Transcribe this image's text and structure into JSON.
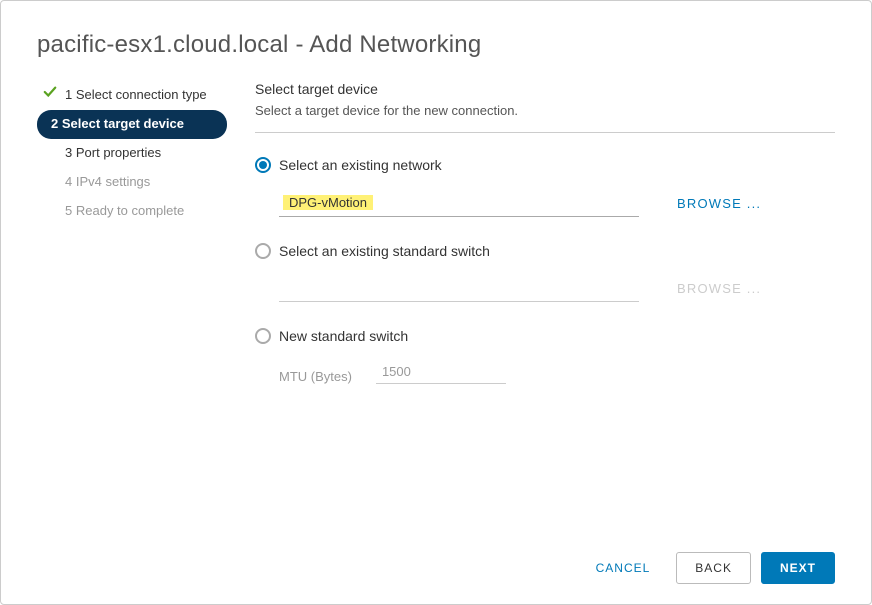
{
  "title": "pacific-esx1.cloud.local - Add Networking",
  "sidebar": {
    "steps": [
      {
        "num": "1",
        "label": "Select connection type"
      },
      {
        "num": "2",
        "label": "Select target device"
      },
      {
        "num": "3",
        "label": "Port properties"
      },
      {
        "num": "4",
        "label": "IPv4 settings"
      },
      {
        "num": "5",
        "label": "Ready to complete"
      }
    ]
  },
  "panel": {
    "title": "Select target device",
    "subtitle": "Select a target device for the new connection."
  },
  "options": {
    "existing_network": {
      "label": "Select an existing network",
      "value": "DPG-vMotion",
      "browse": "BROWSE ..."
    },
    "existing_switch": {
      "label": "Select an existing standard switch",
      "value": "",
      "browse": "BROWSE ..."
    },
    "new_switch": {
      "label": "New standard switch",
      "mtu_label": "MTU (Bytes)",
      "mtu_value": "1500"
    }
  },
  "footer": {
    "cancel": "CANCEL",
    "back": "BACK",
    "next": "NEXT"
  }
}
